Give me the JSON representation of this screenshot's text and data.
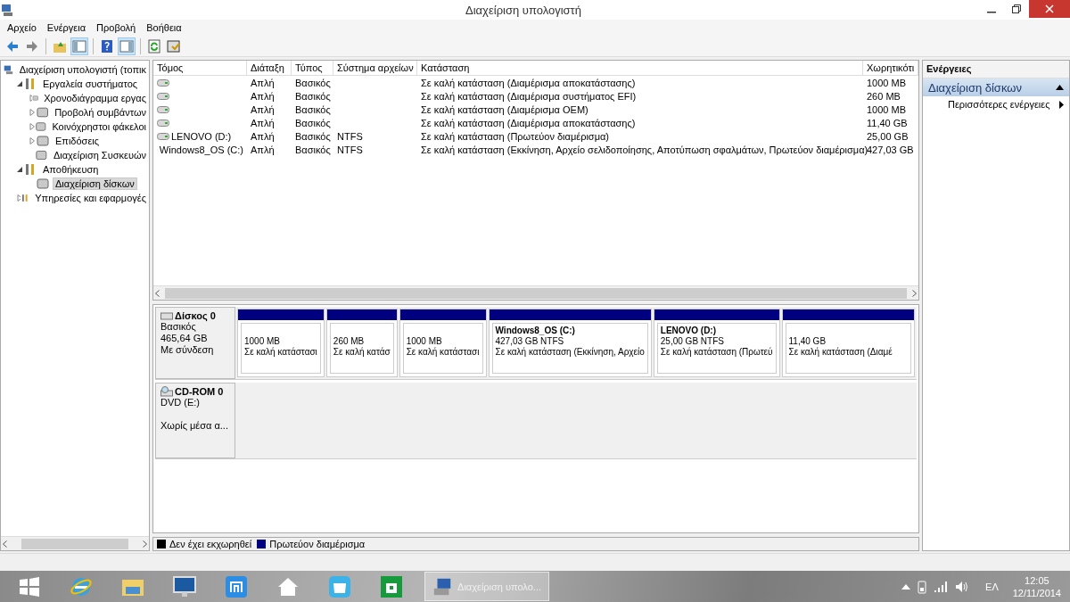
{
  "window": {
    "title": "Διαχείριση υπολογιστή"
  },
  "menu": [
    "Αρχείο",
    "Ενέργεια",
    "Προβολή",
    "Βοήθεια"
  ],
  "toolbar": [
    {
      "kind": "back",
      "pressed": false
    },
    {
      "kind": "forward",
      "pressed": false
    },
    {
      "kind": "separator"
    },
    {
      "kind": "up",
      "pressed": false
    },
    {
      "kind": "tree-pane",
      "pressed": true
    },
    {
      "kind": "separator"
    },
    {
      "kind": "help",
      "pressed": false
    },
    {
      "kind": "action-pane",
      "pressed": true
    },
    {
      "kind": "separator"
    },
    {
      "kind": "refresh",
      "pressed": false
    },
    {
      "kind": "properties",
      "pressed": false
    }
  ],
  "tree": [
    {
      "label": "Διαχείριση υπολογιστή (τοπικ",
      "selected": false,
      "children": [
        {
          "label": "Εργαλεία συστήματος",
          "expanded": true,
          "selected": false,
          "children": [
            {
              "label": "Χρονοδιάγραμμα εργας",
              "expanded": false,
              "selected": false
            },
            {
              "label": "Προβολή συμβάντων",
              "expanded": false,
              "selected": false
            },
            {
              "label": "Κοινόχρηστοι φάκελοι",
              "expanded": false,
              "selected": false
            },
            {
              "label": "Επιδόσεις",
              "expanded": false,
              "selected": false
            },
            {
              "label": "Διαχείριση Συσκευών",
              "selected": false
            }
          ]
        },
        {
          "label": "Αποθήκευση",
          "expanded": true,
          "selected": false,
          "children": [
            {
              "label": "Διαχείριση δίσκων",
              "selected": true
            }
          ]
        },
        {
          "label": "Υπηρεσίες και εφαρμογές",
          "expanded": false,
          "selected": false
        }
      ]
    }
  ],
  "volumes": {
    "columns": [
      "Τόμος",
      "Διάταξη",
      "Τύπος",
      "Σύστημα αρχείων",
      "Κατάσταση",
      "Χωρητικότι"
    ],
    "rows": [
      {
        "layout": "Απλή",
        "type": "Βασικός",
        "status": "Σε καλή κατάσταση (Διαμέρισμα αποκατάστασης)",
        "capacity": "1000 MB"
      },
      {
        "layout": "Απλή",
        "type": "Βασικός",
        "status": "Σε καλή κατάσταση (Διαμέρισμα συστήματος EFI)",
        "capacity": "260 MB"
      },
      {
        "layout": "Απλή",
        "type": "Βασικός",
        "status": "Σε καλή κατάσταση (Διαμέρισμα OEM)",
        "capacity": "1000 MB"
      },
      {
        "layout": "Απλή",
        "type": "Βασικός",
        "status": "Σε καλή κατάσταση (Διαμέρισμα αποκατάστασης)",
        "capacity": "11,40 GB"
      },
      {
        "volume": "LENOVO (D:)",
        "layout": "Απλή",
        "type": "Βασικός",
        "fs": "NTFS",
        "status": "Σε καλή κατάσταση (Πρωτεύον διαμέρισμα)",
        "capacity": "25,00 GB"
      },
      {
        "volume": "Windows8_OS (C:)",
        "layout": "Απλή",
        "type": "Βασικός",
        "fs": "NTFS",
        "status": "Σε καλή κατάσταση (Εκκίνηση, Αρχείο σελιδοποίησης, Αποτύπωση σφαλμάτων, Πρωτεύον διαμέρισμα)",
        "capacity": "427,03 GB"
      }
    ]
  },
  "disks": [
    {
      "kind": "disk",
      "name": "Δίσκος 0",
      "lines": [
        "Βασικός",
        "465,64 GB",
        "Με σύνδεση"
      ],
      "partitions": [
        {
          "kind": "primary",
          "size": "1000 MB",
          "status": "Σε καλή κατάστασι"
        },
        {
          "kind": "primary",
          "size": "260 MB",
          "status": "Σε καλή κατάσ"
        },
        {
          "kind": "primary",
          "size": "1000 MB",
          "status": "Σε καλή κατάστασι"
        },
        {
          "kind": "primary",
          "name": "Windows8_OS  (C:)",
          "size": "427,03 GB NTFS",
          "status": "Σε καλή κατάσταση (Εκκίνηση, Αρχείο"
        },
        {
          "kind": "primary",
          "name": "LENOVO  (D:)",
          "size": "25,00 GB NTFS",
          "status": "Σε καλή κατάσταση (Πρωτεύ"
        },
        {
          "kind": "primary",
          "size": "11,40 GB",
          "status": "Σε καλή κατάσταση (Διαμέ"
        }
      ]
    },
    {
      "kind": "cdrom",
      "name": "CD-ROM 0",
      "lines": [
        "DVD (E:)",
        "Χωρίς μέσα α..."
      ]
    }
  ],
  "legend": [
    {
      "kind": "unallocated",
      "label": "Δεν έχει εκχωρηθεί",
      "color": "#000000"
    },
    {
      "kind": "primary",
      "label": "Πρωτεύον διαμέρισμα",
      "color": "#000080"
    }
  ],
  "actions": {
    "header": "Ενέργειες",
    "section": "Διαχείριση δίσκων",
    "items": [
      "Περισσότερες ενέργειες"
    ]
  },
  "taskbar": {
    "apps": [
      {
        "kind": "start"
      },
      {
        "kind": "ie"
      },
      {
        "kind": "explorer"
      },
      {
        "kind": "monitor"
      },
      {
        "kind": "maxthon"
      },
      {
        "kind": "home"
      },
      {
        "kind": "bag"
      },
      {
        "kind": "store"
      }
    ],
    "task": "Διαχείριση υπολο...",
    "language": "ΕΛ",
    "time": "12:05",
    "date": "12/11/2014"
  }
}
